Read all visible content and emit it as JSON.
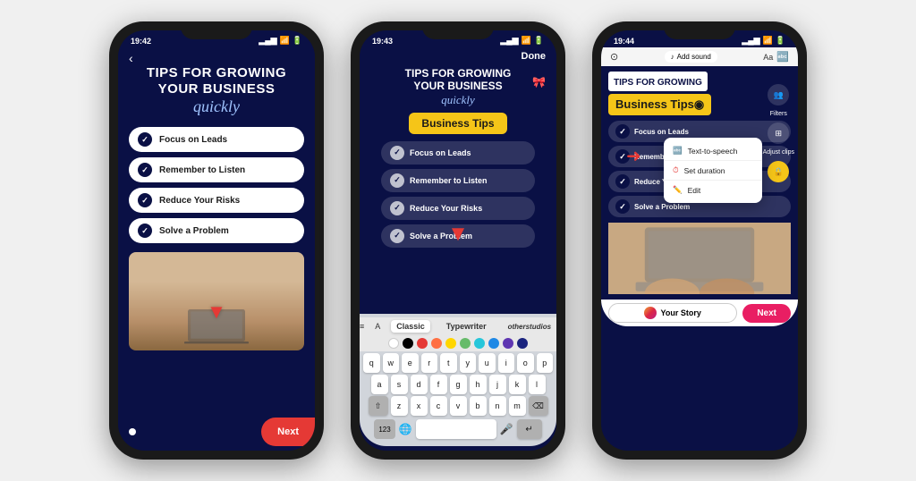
{
  "phones": [
    {
      "id": "phone1",
      "status_time": "19:42",
      "title_line1": "TIPS FOR GROWING",
      "title_line2": "YOUR BUSINESS",
      "title_script": "quickly",
      "checklist": [
        "Focus on Leads",
        "Remember to Listen",
        "Reduce Your Risks",
        "Solve a Problem"
      ],
      "next_label": "Next"
    },
    {
      "id": "phone2",
      "status_time": "19:43",
      "done_label": "Done",
      "title_line1": "TIPS FOR GROWING",
      "title_line2": "YOUR BUSINESS",
      "title_script": "quickly",
      "badge_label": "Business Tips",
      "checklist": [
        "Focus on Leads",
        "Remember to Listen",
        "Reduce Your Risks",
        "Solve a Problem"
      ],
      "text_styles": [
        "Classic",
        "Typewriter",
        "otherstudios"
      ],
      "colors": [
        "#ffffff",
        "#000000",
        "#e53935",
        "#ff7043",
        "#ffd600",
        "#66bb6a",
        "#26c6da",
        "#1e88e5",
        "#5e35b1",
        "#1a237e"
      ],
      "keyboard_rows": [
        [
          "q",
          "w",
          "e",
          "r",
          "t",
          "y",
          "u",
          "i",
          "o",
          "p"
        ],
        [
          "a",
          "s",
          "d",
          "f",
          "g",
          "h",
          "j",
          "k",
          "l"
        ],
        [
          "z",
          "x",
          "c",
          "v",
          "b",
          "n",
          "m"
        ]
      ]
    },
    {
      "id": "phone3",
      "status_time": "19:44",
      "add_sound_label": "Add sound",
      "title_line1": "TIPS FOR GROWING",
      "badge_label": "Business Tips◉",
      "checklist": [
        "Focus on Leads",
        "Remember to Listen",
        "Reduce Your Risks",
        "Solve a Problem"
      ],
      "context_menu": [
        {
          "icon": "🔤",
          "label": "Text-to-speech"
        },
        {
          "icon": "⏱",
          "label": "Set duration"
        },
        {
          "icon": "✏️",
          "label": "Edit"
        }
      ],
      "side_tools": [
        {
          "icon": "👥",
          "label": "Filters"
        },
        {
          "icon": "⊞",
          "label": "Adjust clips"
        },
        {
          "icon": "🔒",
          "label": ""
        }
      ],
      "your_story_label": "Your Story",
      "next_label": "Next"
    }
  ]
}
